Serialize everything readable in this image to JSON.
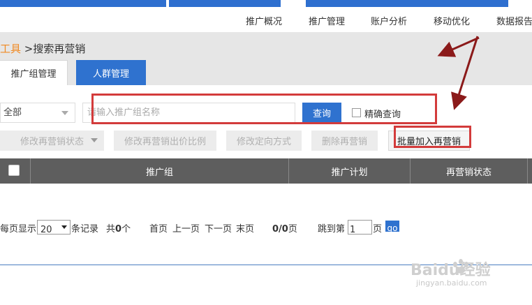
{
  "top_nav": {
    "items": [
      "推广概况",
      "推广管理",
      "账户分析",
      "移动优化",
      "数据报告"
    ]
  },
  "breadcrumb": {
    "parent": "工具",
    "separator": ">",
    "current": "搜索再营销"
  },
  "tabs": {
    "group_management": "推广组管理",
    "audience_management": "人群管理"
  },
  "filters": {
    "scope_select": "全部",
    "search_placeholder": "请输入推广组名称",
    "query_button": "查询",
    "exact_label": "精确查询"
  },
  "actions": {
    "modify_status": "修改再营销状态",
    "modify_bid_ratio": "修改再营销出价比例",
    "modify_targeting": "修改定向方式",
    "delete": "删除再营销",
    "batch_add": "批量加入再营销"
  },
  "table": {
    "headers": [
      "推广组",
      "推广计划",
      "再营销状态"
    ]
  },
  "pagination": {
    "per_page_prefix": "每页显示",
    "page_size": "20",
    "per_page_suffix": "条记录",
    "total_prefix": "共",
    "total_count": "0",
    "total_suffix": "个",
    "first": "首页",
    "prev": "上一页",
    "next": "下一页",
    "last": "末页",
    "page_status": "0/0",
    "page_suffix": "页",
    "jump_prefix": "跳到第",
    "jump_value": "1",
    "jump_suffix": "页",
    "go": "go"
  },
  "watermark": {
    "logo": "Baidu经验",
    "url": "jingyan.baidu.com"
  },
  "colors": {
    "brand_blue": "#2f72cf",
    "highlight_red": "#d33b3b",
    "crumb_orange": "#f08a24",
    "table_header": "#5e5e5e",
    "arrow": "#8b1a1a"
  }
}
